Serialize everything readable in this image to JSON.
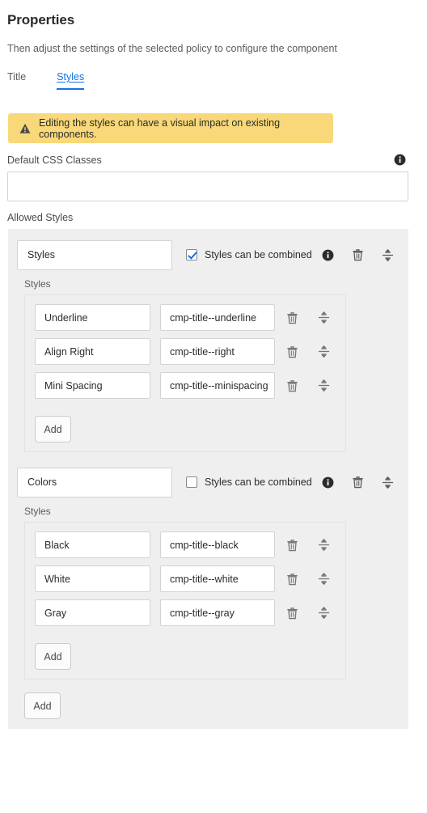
{
  "header": {
    "title": "Properties",
    "subtitle": "Then adjust the settings of the selected policy to configure the component"
  },
  "tabs": [
    {
      "label": "Title",
      "active": false
    },
    {
      "label": "Styles",
      "active": true
    }
  ],
  "warning": {
    "icon": "warning-triangle-icon",
    "text": "Editing the styles can have a visual impact on existing components.",
    "background": "#f8d878"
  },
  "default_css_classes": {
    "label": "Default CSS Classes",
    "value": "",
    "placeholder": "",
    "info_icon": "info-icon"
  },
  "allowed_styles": {
    "label": "Allowed Styles",
    "add_label": "Add",
    "groups": [
      {
        "name": "Styles",
        "combined_label": "Styles can be combined",
        "combined_checked": true,
        "sub_label": "Styles",
        "add_label": "Add",
        "rows": [
          {
            "name": "Underline",
            "css_class": "cmp-title--underline"
          },
          {
            "name": "Align Right",
            "css_class": "cmp-title--right"
          },
          {
            "name": "Mini Spacing",
            "css_class": "cmp-title--minispacing"
          }
        ]
      },
      {
        "name": "Colors",
        "combined_label": "Styles can be combined",
        "combined_checked": false,
        "sub_label": "Styles",
        "add_label": "Add",
        "rows": [
          {
            "name": "Black",
            "css_class": "cmp-title--black"
          },
          {
            "name": "White",
            "css_class": "cmp-title--white"
          },
          {
            "name": "Gray",
            "css_class": "cmp-title--gray"
          }
        ]
      }
    ]
  },
  "icons": {
    "info": "info-icon",
    "delete": "trash-icon",
    "reorder": "drag-reorder-icon"
  },
  "colors": {
    "accent": "#1473e6",
    "warning_bg": "#f8d878",
    "panel_bg": "#efefef",
    "border": "#d3d3d3"
  }
}
